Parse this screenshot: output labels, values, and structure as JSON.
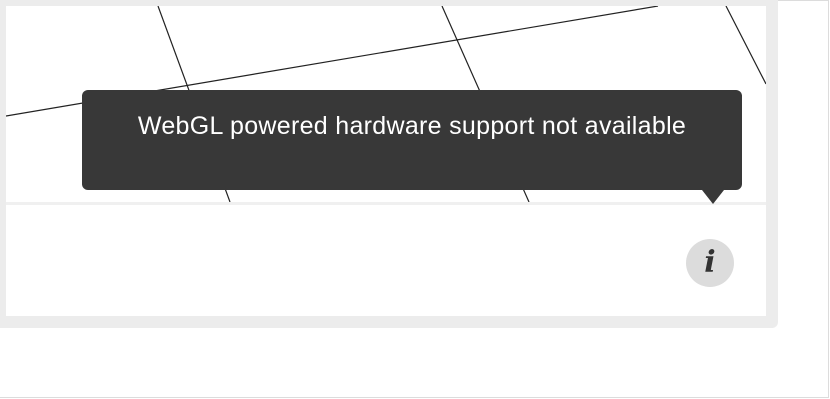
{
  "tooltip": {
    "message": "WebGL powered hardware support not available"
  },
  "info_button": {
    "glyph": "i",
    "icon": "info-icon"
  },
  "colors": {
    "tooltip_background": "#383838",
    "tooltip_text": "#ffffff",
    "info_button_background": "#dcdcdc",
    "card_border": "#ececec"
  }
}
